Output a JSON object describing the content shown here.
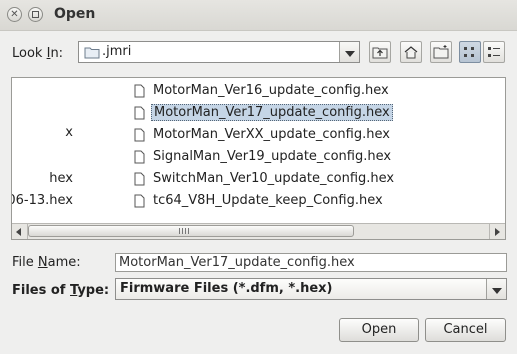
{
  "window": {
    "title": "Open"
  },
  "look_in": {
    "label": "Look In:",
    "label_prefix": "Look ",
    "label_mnemonic": "I",
    "label_suffix": "n:",
    "value": ".jmri"
  },
  "toolbar": {
    "buttons": [
      {
        "name": "up-one-level-icon"
      },
      {
        "name": "home-icon"
      },
      {
        "name": "new-folder-icon"
      },
      {
        "name": "list-view-icon",
        "active": true
      },
      {
        "name": "details-view-icon"
      }
    ]
  },
  "files": {
    "clipped_column": [
      "x",
      "hex",
      "06-13.hex"
    ],
    "items": [
      {
        "name": "MotorMan_Ver16_update_config.hex",
        "selected": false
      },
      {
        "name": "MotorMan_Ver17_update_config.hex",
        "selected": true
      },
      {
        "name": "MotorMan_VerXX_update_config.hex",
        "selected": false
      },
      {
        "name": "SignalMan_Ver19_update_config.hex",
        "selected": false
      },
      {
        "name": "SwitchMan_Ver10_update_config.hex",
        "selected": false
      },
      {
        "name": "tc64_V8H_Update_keep_Config.hex",
        "selected": false
      }
    ]
  },
  "file_name": {
    "label": "File Name:",
    "label_prefix": "File ",
    "label_mnemonic": "N",
    "label_suffix": "ame:",
    "value": "MotorMan_Ver17_update_config.hex"
  },
  "file_type": {
    "label": "Files of Type:",
    "label_prefix": "Files of ",
    "label_mnemonic": "T",
    "label_suffix": "ype:",
    "value": "Firmware Files (*.dfm, *.hex)"
  },
  "buttons": {
    "open": "Open",
    "cancel": "Cancel"
  }
}
